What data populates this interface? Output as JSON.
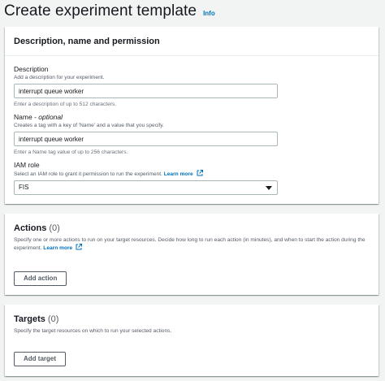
{
  "page": {
    "title": "Create experiment template",
    "info_link": "Info"
  },
  "description_section": {
    "title": "Description, name and permission",
    "description": {
      "label": "Description",
      "hint": "Add a description for your experiment.",
      "value": "interrupt queue worker",
      "constraint": "Enter a description of up to 512 characters."
    },
    "name": {
      "label": "Name",
      "label_suffix": " - optional",
      "hint": "Creates a tag with a key of 'Name' and a value that you specify.",
      "value": "interrupt queue worker",
      "constraint": "Enter a Name tag value of up to 256 characters."
    },
    "iam_role": {
      "label": "IAM role",
      "hint": "Select an IAM role to grant it permission to run the experiment.",
      "learn_more": "Learn more",
      "selected": "FIS"
    }
  },
  "actions_section": {
    "title": "Actions",
    "count": "(0)",
    "description": "Specify one or more actions to run on your target resources. Decide how long to run each action (in minutes), and when to start the action during the experiment.",
    "learn_more": "Learn more",
    "button": "Add action"
  },
  "targets_section": {
    "title": "Targets",
    "count": "(0)",
    "description": "Specify the target resources on which to run your selected actions.",
    "button": "Add target"
  },
  "colors": {
    "background": "#f2f3f3",
    "link": "#0073bb",
    "text": "#16191f",
    "secondary_text": "#545b64"
  }
}
